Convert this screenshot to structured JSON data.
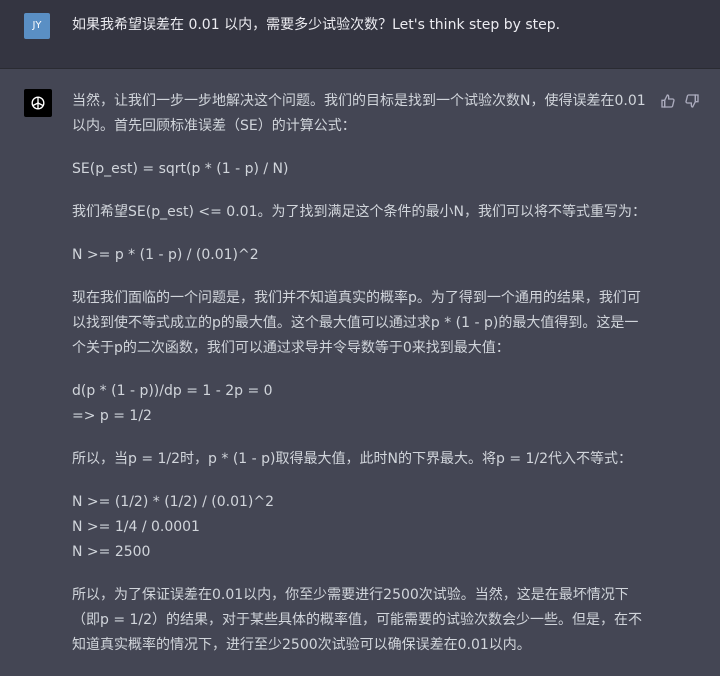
{
  "user": {
    "avatar_initials": "JY",
    "message": "如果我希望误差在 0.01 以内，需要多少试验次数？Let's think step by step."
  },
  "assistant": {
    "icons": [
      "openai-logo-icon",
      "thumbs-up-icon",
      "thumbs-down-icon"
    ],
    "paragraphs": [
      "当然，让我们一步一步地解决这个问题。我们的目标是找到一个试验次数N，使得误差在0.01以内。首先回顾标准误差（SE）的计算公式：",
      "SE(p_est) = sqrt(p * (1 - p) / N)",
      "我们希望SE(p_est) <= 0.01。为了找到满足这个条件的最小N，我们可以将不等式重写为：",
      "N >= p * (1 - p) / (0.01)^2",
      "现在我们面临的一个问题是，我们并不知道真实的概率p。为了得到一个通用的结果，我们可以找到使不等式成立的p的最大值。这个最大值可以通过求p * (1 - p)的最大值得到。这是一个关于p的二次函数，我们可以通过求导并令导数等于0来找到最大值：",
      "d(p * (1 - p))/dp = 1 - 2p = 0\n=> p = 1/2",
      "所以，当p = 1/2时，p * (1 - p)取得最大值，此时N的下界最大。将p = 1/2代入不等式：",
      "N >= (1/2) * (1/2) / (0.01)^2\nN >= 1/4 / 0.0001\nN >= 2500",
      "所以，为了保证误差在0.01以内，你至少需要进行2500次试验。当然，这是在最坏情况下（即p = 1/2）的结果，对于某些具体的概率值，可能需要的试验次数会少一些。但是，在不知道真实概率的情况下，进行至少2500次试验可以确保误差在0.01以内。"
    ]
  }
}
